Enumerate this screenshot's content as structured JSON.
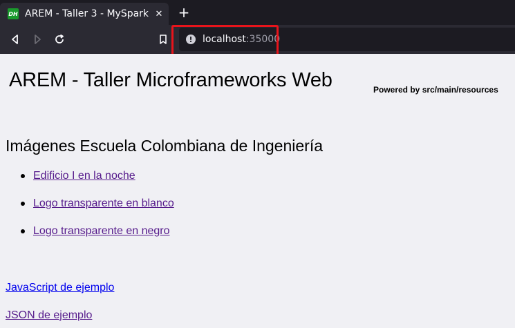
{
  "browser": {
    "tab": {
      "favicon_text": "DH",
      "title": "AREM - Taller 3 - MySpark",
      "close_glyph": "✕"
    },
    "new_tab_glyph": "+",
    "url": {
      "host": "localhost",
      "port": ":35000"
    },
    "highlight_color": "#e8141b"
  },
  "page": {
    "heading": "AREM - Taller Microframeworks Web",
    "powered_by": "Powered by src/main/resources",
    "images_heading": "Imágenes Escuela Colombiana de Ingeniería",
    "image_links": [
      {
        "label": "Edificio I en la noche"
      },
      {
        "label": "Logo transparente en blanco"
      },
      {
        "label": "Logo transparente en negro"
      }
    ],
    "js_link": "JavaScript de ejemplo",
    "json_link": "JSON de ejemplo"
  },
  "colors": {
    "visited_link": "#551a8b",
    "unvisited_link": "#0000ee"
  }
}
